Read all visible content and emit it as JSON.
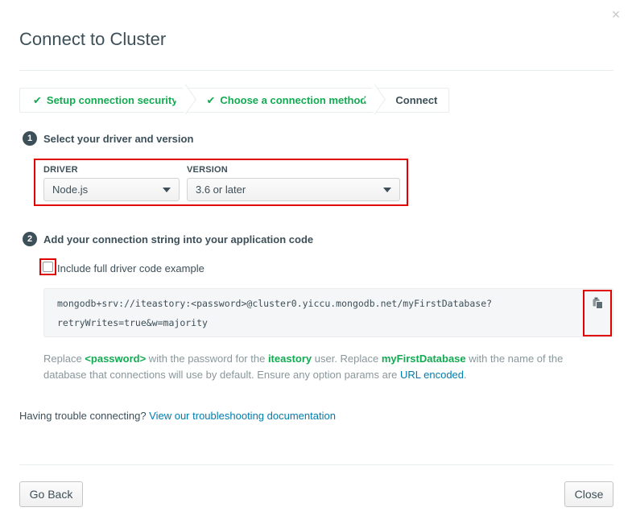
{
  "modal": {
    "title": "Connect to Cluster",
    "close_glyph": "×"
  },
  "steps": [
    {
      "label": "Setup connection security",
      "status": "done"
    },
    {
      "label": "Choose a connection method",
      "status": "done"
    },
    {
      "label": "Connect",
      "status": "current"
    }
  ],
  "section1": {
    "number": "1",
    "title": "Select your driver and version",
    "driver_label": "DRIVER",
    "driver_value": "Node.js",
    "version_label": "VERSION",
    "version_value": "3.6 or later"
  },
  "section2": {
    "number": "2",
    "title": "Add your connection string into your application code",
    "checkbox_label": "Include full driver code example",
    "checkbox_checked": false,
    "code_line1": "mongodb+srv://iteastory:<password>@cluster0.yiccu.mongodb.net/myFirstDatabase?",
    "code_line2": "retryWrites=true&w=majority"
  },
  "help": {
    "t1": "Replace ",
    "password": "<password>",
    "t2": " with the password for the ",
    "user": "iteastory",
    "t3": " user. Replace ",
    "db": "myFirstDatabase",
    "t4": " with the name of the database that connections will use by default. Ensure any option params are ",
    "link": "URL encoded",
    "t5": "."
  },
  "trouble": {
    "text": "Having trouble connecting? ",
    "link": "View our troubleshooting documentation"
  },
  "footer": {
    "back_label": "Go Back",
    "close_label": "Close"
  },
  "colors": {
    "accent_green": "#13aa52",
    "link_blue": "#007cad",
    "highlight_red": "#e00000",
    "text_dark": "#3d4f58"
  },
  "icons": [
    "close-icon",
    "check-icon",
    "caret-down-icon",
    "copy-icon"
  ]
}
